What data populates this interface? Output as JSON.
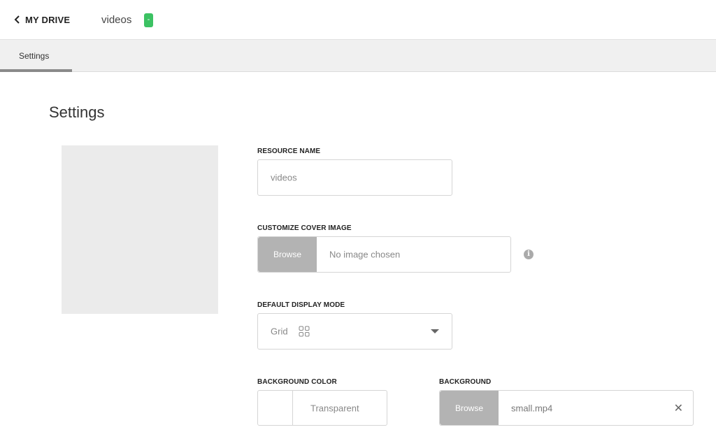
{
  "topbar": {
    "back_label": "MY DRIVE",
    "resource_crumb": "videos",
    "status_badge": "-"
  },
  "tabs": [
    {
      "label": "Settings",
      "active": true
    }
  ],
  "page": {
    "title": "Settings"
  },
  "form": {
    "resource_name": {
      "label": "RESOURCE NAME",
      "value": "videos"
    },
    "cover_image": {
      "label": "CUSTOMIZE COVER IMAGE",
      "browse_label": "Browse",
      "value": "No image chosen",
      "info_icon": "info-icon"
    },
    "display_mode": {
      "label": "DEFAULT DISPLAY MODE",
      "value": "Grid",
      "icon": "grid-icon"
    },
    "background_color": {
      "label": "BACKGROUND COLOR",
      "value": "Transparent"
    },
    "background": {
      "label": "BACKGROUND",
      "browse_label": "Browse",
      "value": "small.mp4",
      "clear_icon": "close-icon"
    }
  },
  "colors": {
    "badge": "#3cc263",
    "browse_button": "#b3b3b3",
    "cover_placeholder": "#ebebeb",
    "tab_bar": "#f0f0f0"
  }
}
